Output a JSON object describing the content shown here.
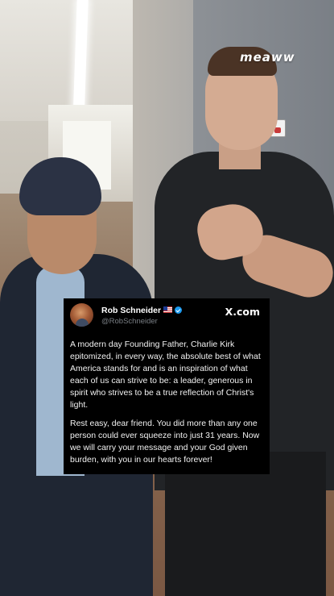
{
  "watermark": {
    "text": "meaww"
  },
  "tweet": {
    "author_name": "Rob Schneider",
    "author_handle": "@RobSchneider",
    "badge_icons": [
      "us-flag-icon",
      "verified-icon"
    ],
    "platform_label": "X.com",
    "paragraphs": [
      "A modern day Founding Father, Charlie Kirk epitomized, in every way, the absolute best of what America stands for and is an inspiration of what each of us can strive to be: a leader, generous in spirit who strives to be a true reflection of Christ's light.",
      "Rest easy, dear friend. You did more than any one person could ever squeeze into just 31 years. Now we will carry your message and your God given burden, with you in our hearts forever!"
    ]
  },
  "colors": {
    "card_background": "#000000",
    "verified_blue": "#1d9bf0",
    "handle_gray": "#7a7f85"
  }
}
